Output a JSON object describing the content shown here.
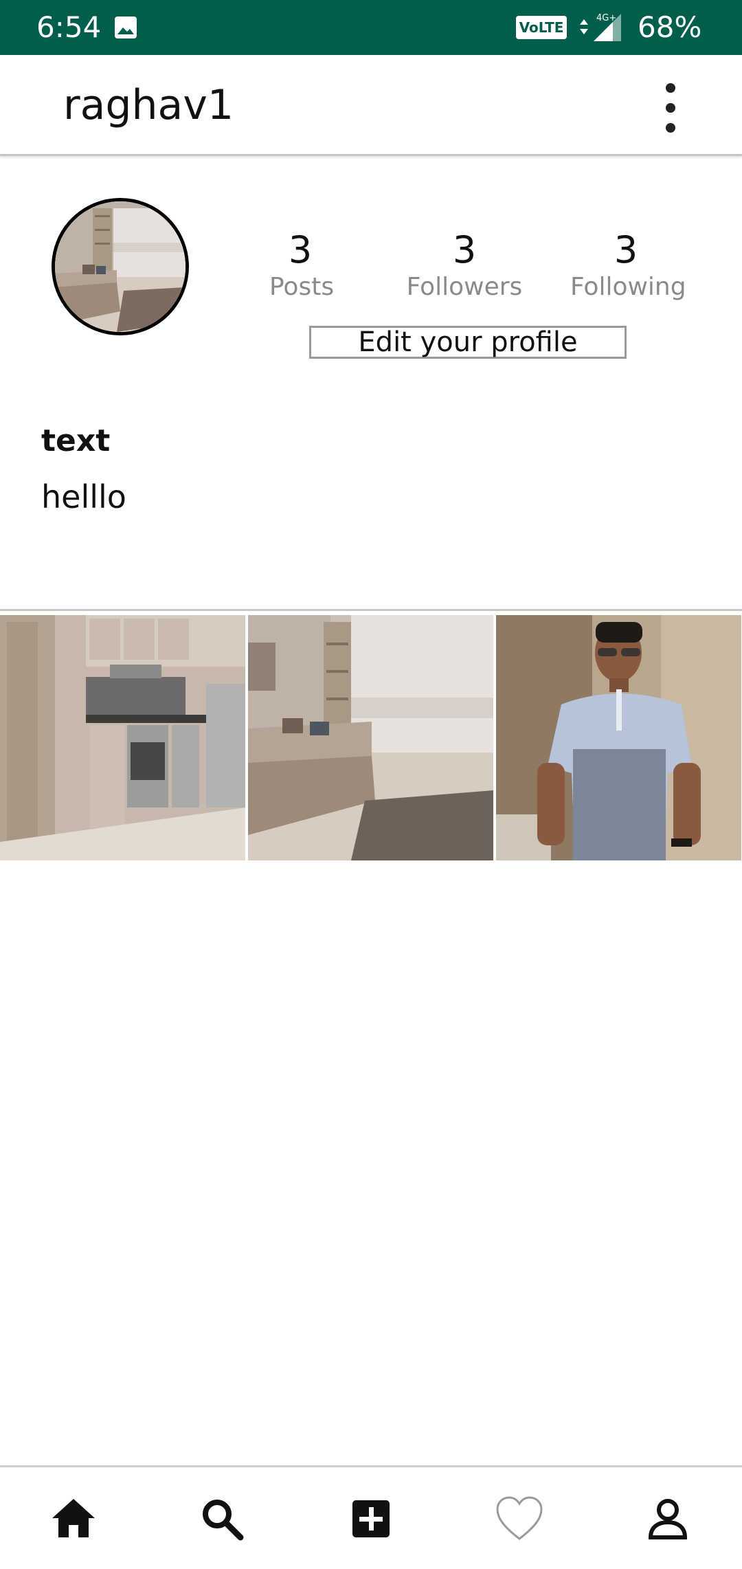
{
  "status_bar": {
    "time": "6:54",
    "volte": "VoLTE",
    "network": "4G+",
    "battery": "68%",
    "background_color": "#015e4d"
  },
  "app_bar": {
    "title": "raghav1",
    "more_icon": "more-vert-icon"
  },
  "profile": {
    "avatar_icon": "living-room-photo",
    "stats": [
      {
        "value": "3",
        "label": "Posts"
      },
      {
        "value": "3",
        "label": "Followers"
      },
      {
        "value": "3",
        "label": "Following"
      }
    ],
    "edit_button_label": "Edit your profile"
  },
  "bio": {
    "name": "text",
    "text": "helllo"
  },
  "posts": [
    {
      "icon": "kitchen-photo"
    },
    {
      "icon": "living-room-photo"
    },
    {
      "icon": "man-portrait-photo"
    }
  ],
  "bottom_nav": {
    "items": [
      {
        "icon": "home-icon"
      },
      {
        "icon": "search-icon"
      },
      {
        "icon": "add-box-icon"
      },
      {
        "icon": "heart-outline-icon"
      },
      {
        "icon": "person-icon"
      }
    ]
  }
}
